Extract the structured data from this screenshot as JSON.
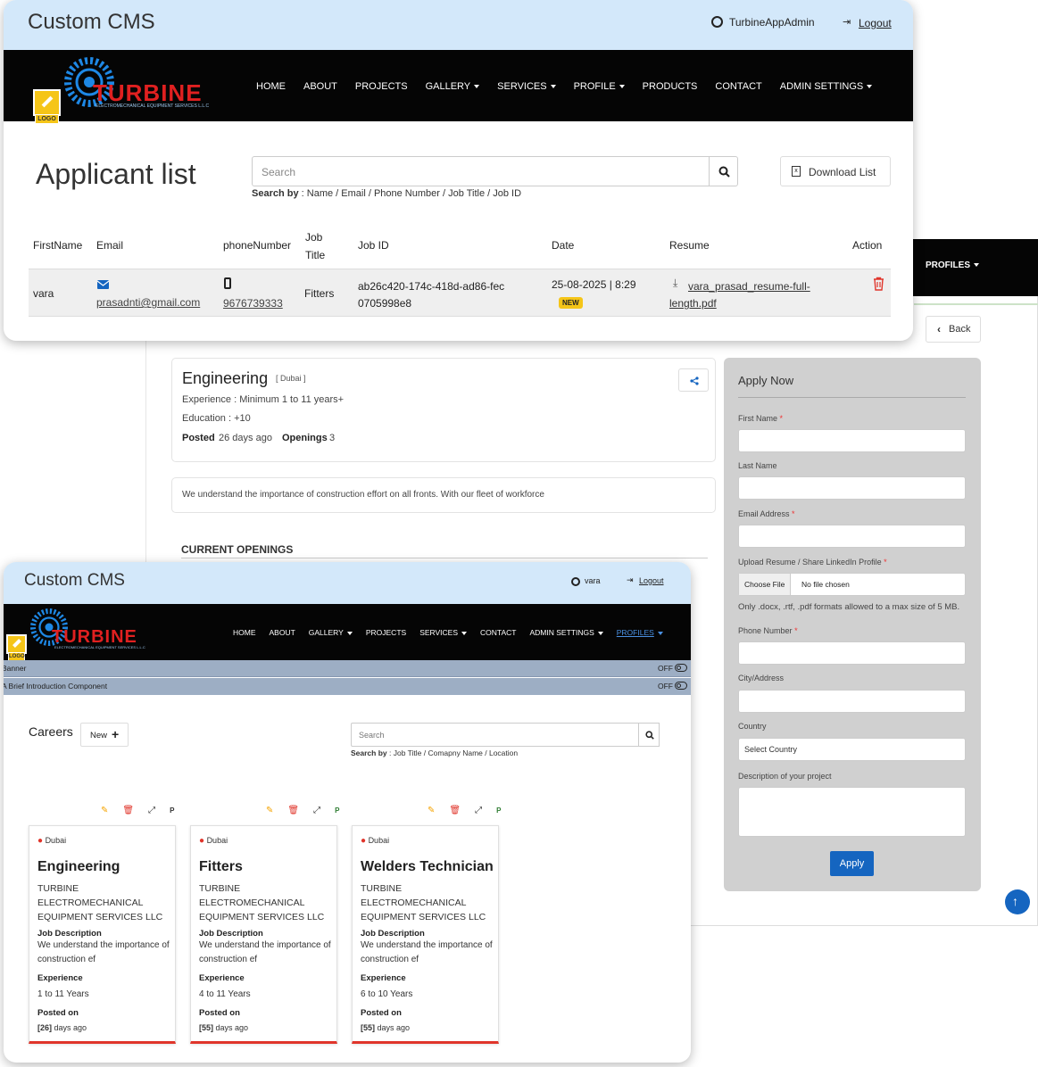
{
  "top_window": {
    "brand": "Custom CMS",
    "user": "TurbineAppAdmin",
    "logout": "Logout",
    "nav": [
      "HOME",
      "ABOUT",
      "PROJECTS",
      "GALLERY",
      "SERVICES",
      "PROFILE",
      "PRODUCTS",
      "CONTACT",
      "ADMIN SETTINGS"
    ],
    "logo_text": "TURBINE",
    "logo_sub": "ELECTROMECHANICAL EQUIPMENT SERVICES L.L.C",
    "logo_badge": "LOGO",
    "page_title": "Applicant list",
    "search_placeholder": "Search",
    "search_by_label": "Search by",
    "search_by_fields": " : Name / Email / Phone Number / Job Title / Job ID",
    "download_label": "Download List",
    "columns": [
      "FirstName",
      "Email",
      "phoneNumber",
      "Job Title",
      "Job ID",
      "Date",
      "Resume",
      "Action"
    ],
    "row": {
      "first_name": "vara",
      "email": "prasadnti@gmail.com",
      "phone": "9676739333",
      "job_title": "Fitters",
      "job_id": "ab26c420-174c-418d-ad86-fec0705998e8",
      "date": "25-08-2025 | 8:29",
      "badge": "NEW",
      "resume": "vara_prasad_resume-full-length.pdf"
    }
  },
  "back_window": {
    "profiles_menu": "PROFILES",
    "back": "Back",
    "job_title": "Engineering",
    "job_location": "[ Dubai ]",
    "experience": "Experience : Minimum 1 to 11 years+",
    "education": "Education : +10",
    "posted_label": "Posted",
    "posted_value": "26 days ago",
    "openings_label": "Openings",
    "openings_value": "3",
    "description": "We understand the importance of construction effort on all fronts. With our fleet of workforce",
    "current_openings": "CURRENT OPENINGS",
    "apply": {
      "title": "Apply Now",
      "first_name": "First Name",
      "last_name": "Last Name",
      "email": "Email Address",
      "resume": "Upload Resume / Share LinkedIn Profile",
      "choose_file": "Choose File",
      "no_file": "No file chosen",
      "formats": "Only .docx, .rtf, .pdf formats allowed to a max size of 5 MB.",
      "phone": "Phone Number",
      "city": "City/Address",
      "country": "Country",
      "country_select": "Select Country",
      "project_desc": "Description of your project",
      "submit": "Apply"
    }
  },
  "bottom_window": {
    "brand": "Custom CMS",
    "user": "vara",
    "logout": "Logout",
    "nav": [
      "HOME",
      "ABOUT",
      "GALLERY",
      "PROJECTS",
      "SERVICES",
      "CONTACT",
      "ADMIN SETTINGS",
      "PROFILES"
    ],
    "logo_text": "TURBINE",
    "logo_sub": "ELECTROMECHANICAL EQUIPMENT SERVICES L.L.C",
    "logo_badge": "LOGO",
    "toggles": [
      {
        "label": "Banner",
        "state": "OFF"
      },
      {
        "label": "A Brief Introduction Component",
        "state": "OFF"
      }
    ],
    "section_title": "Careers",
    "new_button": "New",
    "search_placeholder": "Search",
    "search_by_label": "Search by",
    "search_by_fields": " : Job Title / Comapny Name / Location",
    "card_action_p": "P",
    "cards": [
      {
        "location": "Dubai",
        "title": "Engineering",
        "company": "TURBINE ELECTROMECHANICAL EQUIPMENT SERVICES LLC",
        "jd_label": "Job Description",
        "jd": "We understand the importance of construction ef",
        "exp_label": "Experience",
        "exp": "1 to 11 Years",
        "posted_label": "Posted on",
        "posted_days": "[26]",
        "posted_suffix": " days ago"
      },
      {
        "location": "Dubai",
        "title": "Fitters",
        "company": "TURBINE ELECTROMECHANICAL EQUIPMENT SERVICES LLC",
        "jd_label": "Job Description",
        "jd": "We understand the importance of construction ef",
        "exp_label": "Experience",
        "exp": "4 to 11 Years",
        "posted_label": "Posted on",
        "posted_days": "[55]",
        "posted_suffix": " days ago"
      },
      {
        "location": "Dubai",
        "title": "Welders Technician",
        "company": "TURBINE ELECTROMECHANICAL EQUIPMENT SERVICES LLC",
        "jd_label": "Job Description",
        "jd": "We understand the importance of construction ef",
        "exp_label": "Experience",
        "exp": "6 to 10 Years",
        "posted_label": "Posted on",
        "posted_days": "[55]",
        "posted_suffix": " days ago"
      }
    ]
  },
  "colors": {
    "accent_blue": "#1565c0",
    "header_blue": "#d3e8fa",
    "logo_red": "#e02020",
    "badge_yellow": "#f5c518",
    "delete_red": "#e0352b"
  }
}
